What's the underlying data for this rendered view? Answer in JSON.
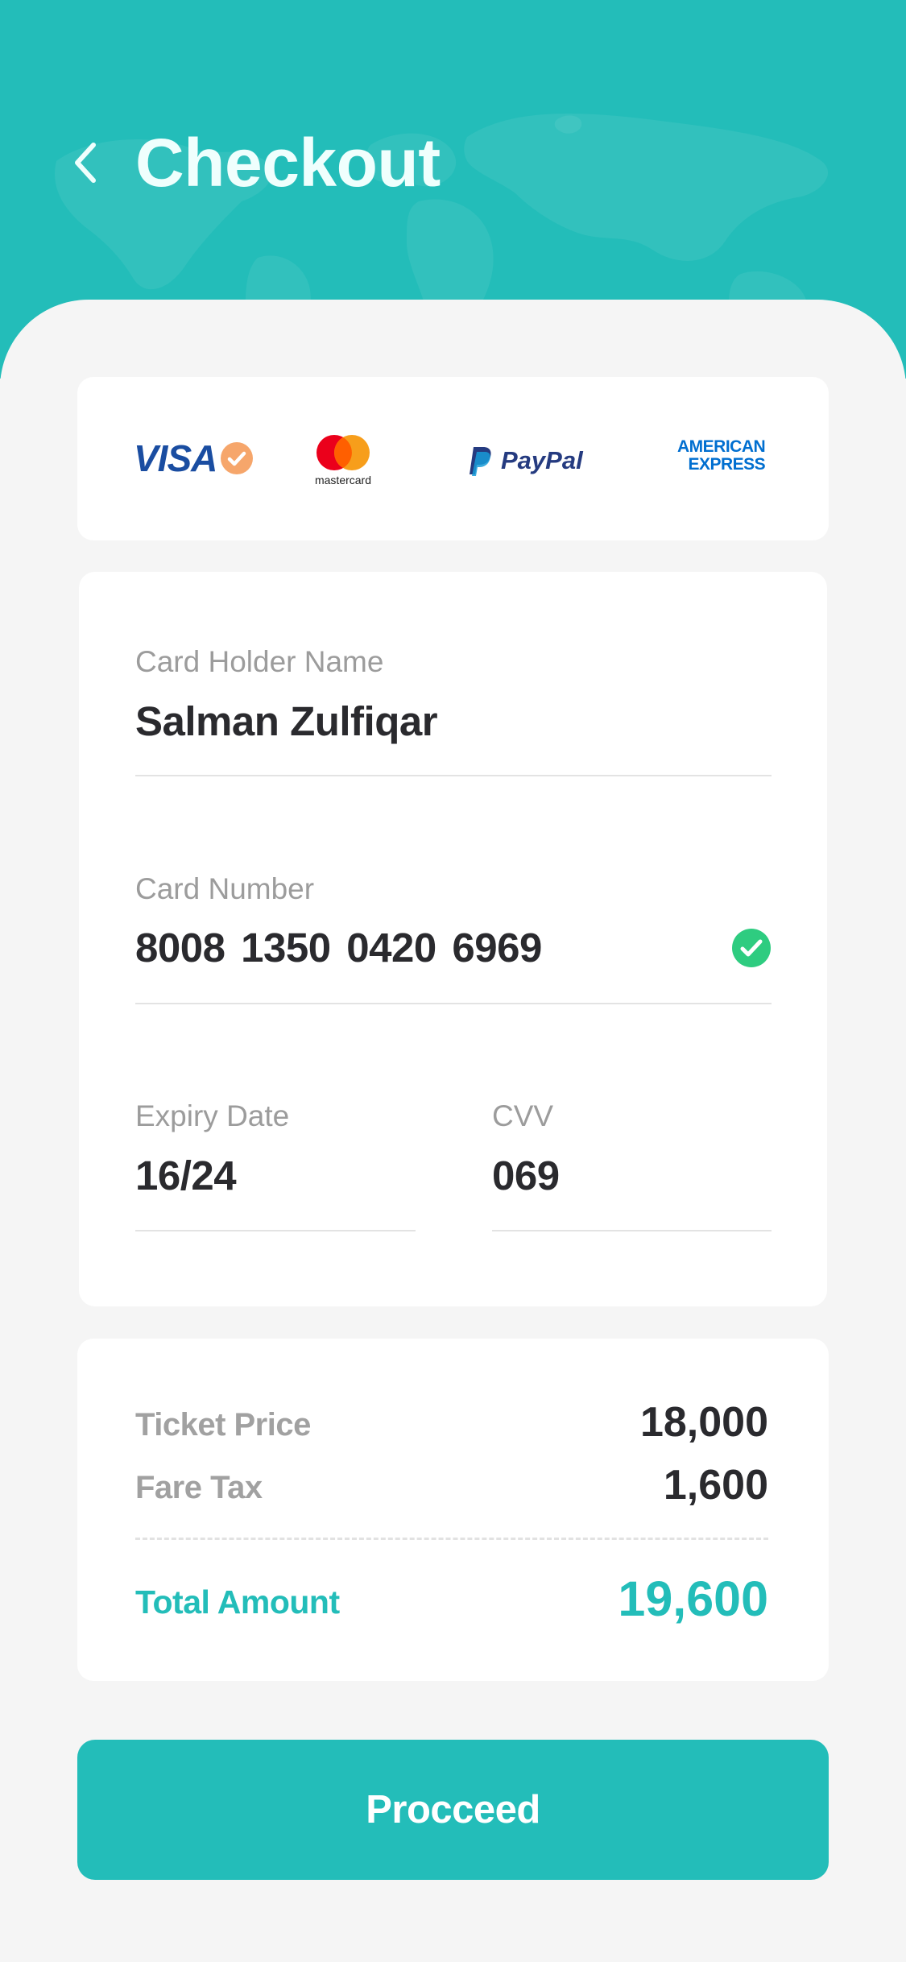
{
  "header": {
    "title": "Checkout",
    "back_icon": "chevron-left-icon",
    "background_color": "#23BDB9"
  },
  "payment_methods": [
    {
      "name": "VISA",
      "icon": "visa-logo",
      "selected": true,
      "check_icon": "check-circle-icon",
      "check_color": "#F6A66B"
    },
    {
      "name": "mastercard",
      "icon": "mastercard-logo",
      "selected": false
    },
    {
      "name": "PayPal",
      "icon": "paypal-logo",
      "selected": false
    },
    {
      "name_line1": "AMERICAN",
      "name_line2": "EXPRESS",
      "icon": "amex-logo",
      "selected": false
    }
  ],
  "form": {
    "card_holder": {
      "label": "Card Holder Name",
      "value": "Salman Zulfiqar"
    },
    "card_number": {
      "label": "Card Number",
      "value": "8008 1350 0420 6969",
      "valid_icon": "check-circle-icon",
      "valid_color": "#2ECC80"
    },
    "expiry": {
      "label": "Expiry Date",
      "value": "16/24"
    },
    "cvv": {
      "label": "CVV",
      "value": "069"
    }
  },
  "summary": {
    "ticket_price": {
      "label": "Ticket Price",
      "value": "18,000"
    },
    "fare_tax": {
      "label": "Fare Tax",
      "value": "1,600"
    },
    "total": {
      "label": "Total Amount",
      "value": "19,600"
    }
  },
  "proceed_button": {
    "label": "Procceed"
  },
  "colors": {
    "accent": "#23BDB9",
    "text_dark": "#2A2A2E",
    "text_muted": "#9C9C9C",
    "background": "#F5F5F5"
  }
}
